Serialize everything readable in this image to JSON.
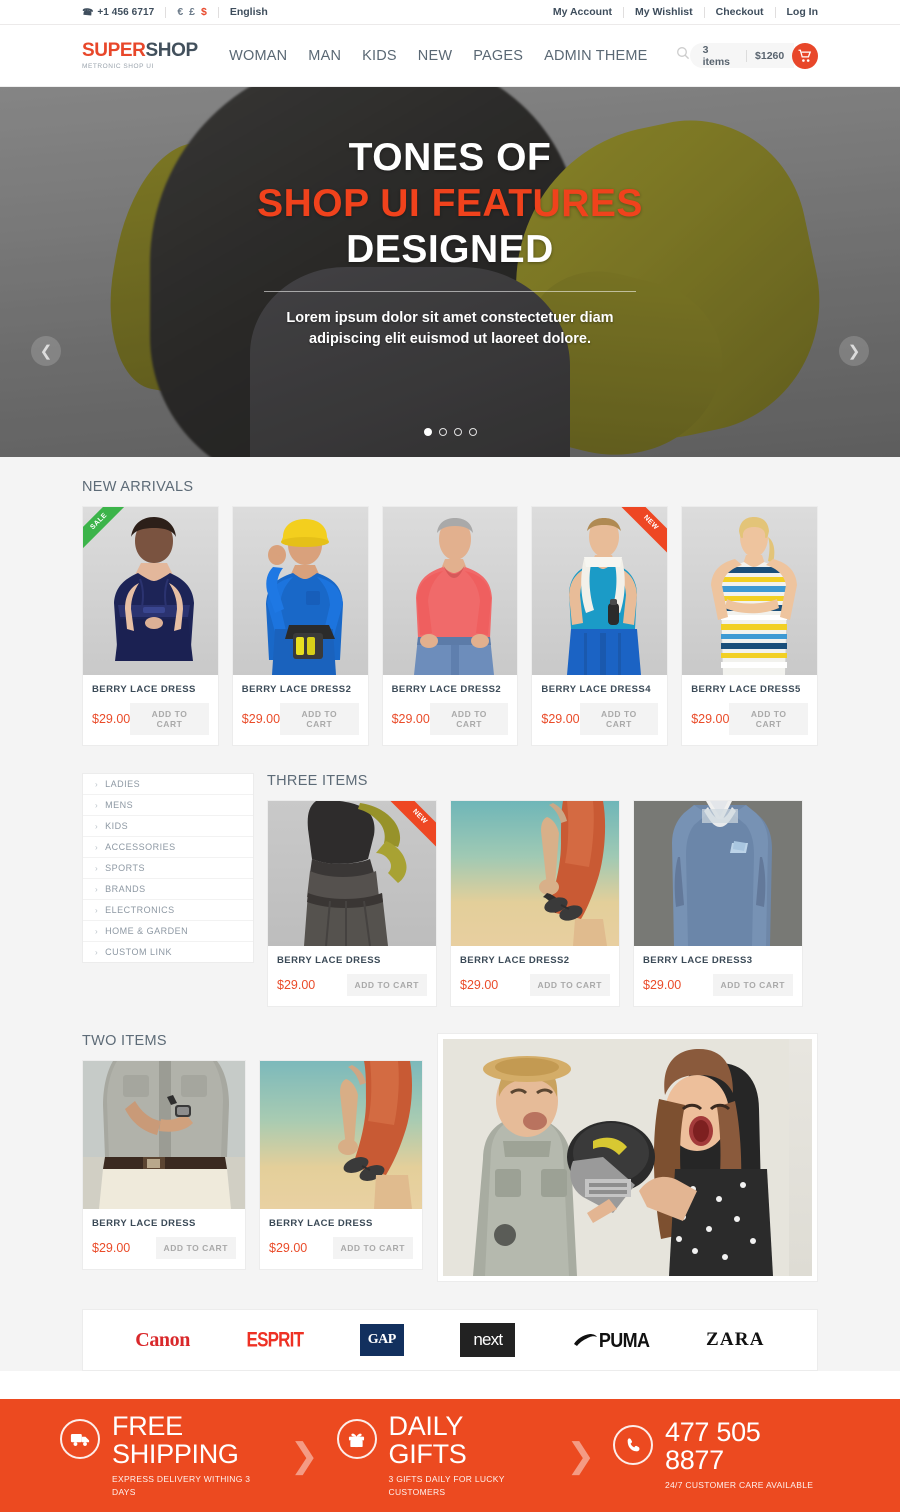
{
  "topbar": {
    "phone": "+1 456 6717",
    "phone_icon": "phone-icon",
    "currencies": [
      {
        "symbol": "€",
        "active": false
      },
      {
        "symbol": "£",
        "active": false
      },
      {
        "symbol": "$",
        "active": true
      }
    ],
    "language": "English",
    "links": [
      "My Account",
      "My Wishlist",
      "Checkout",
      "Log In"
    ]
  },
  "header": {
    "logo_part1": "SUPER",
    "logo_part2": "SHOP",
    "logo_sub": "METRONIC SHOP UI",
    "nav": [
      "WOMAN",
      "MAN",
      "KIDS",
      "NEW",
      "PAGES",
      "ADMIN THEME"
    ],
    "search_icon": "search-icon",
    "cart_items": "3 items",
    "cart_total": "$1260",
    "cart_icon": "shopping-cart-icon"
  },
  "hero": {
    "line1": "TONES OF",
    "line2": "SHOP UI FEATURES",
    "line3": "DESIGNED",
    "subtitle_1": "Lorem ipsum dolor sit amet constectetuer diam",
    "subtitle_2": "adipiscing elit euismod ut laoreet dolore.",
    "prev_icon": "chevron-left-icon",
    "next_icon": "chevron-right-icon",
    "slides": 4,
    "active_slide": 1,
    "accent_color": "#f0421c"
  },
  "new_arrivals": {
    "title": "NEW ARRIVALS",
    "products": [
      {
        "name": "BERRY LACE DRESS",
        "price": "$29.00",
        "cta": "ADD TO CART",
        "badge": "SALE",
        "badge_type": "sale"
      },
      {
        "name": "BERRY LACE DRESS2",
        "price": "$29.00",
        "cta": "ADD TO CART",
        "badge": "",
        "badge_type": ""
      },
      {
        "name": "BERRY LACE DRESS2",
        "price": "$29.00",
        "cta": "ADD TO CART",
        "badge": "",
        "badge_type": ""
      },
      {
        "name": "BERRY LACE DRESS4",
        "price": "$29.00",
        "cta": "ADD TO CART",
        "badge": "NEW",
        "badge_type": "new"
      },
      {
        "name": "BERRY LACE DRESS5",
        "price": "$29.00",
        "cta": "ADD TO CART",
        "badge": "",
        "badge_type": ""
      }
    ]
  },
  "categories": {
    "items": [
      "LADIES",
      "MENS",
      "KIDS",
      "ACCESSORIES",
      "SPORTS",
      "BRANDS",
      "ELECTRONICS",
      "HOME & GARDEN",
      "CUSTOM LINK"
    ],
    "arrow_icon": "chevron-right-icon"
  },
  "three_items": {
    "title": "THREE ITEMS",
    "products": [
      {
        "name": "BERRY LACE DRESS",
        "price": "$29.00",
        "cta": "ADD TO CART",
        "badge": "NEW",
        "badge_type": "new"
      },
      {
        "name": "BERRY LACE DRESS2",
        "price": "$29.00",
        "cta": "ADD TO CART",
        "badge": "",
        "badge_type": ""
      },
      {
        "name": "BERRY LACE DRESS3",
        "price": "$29.00",
        "cta": "ADD TO CART",
        "badge": "",
        "badge_type": ""
      }
    ]
  },
  "two_items": {
    "title": "TWO ITEMS",
    "products": [
      {
        "name": "BERRY LACE DRESS",
        "price": "$29.00",
        "cta": "ADD TO CART"
      },
      {
        "name": "BERRY LACE DRESS",
        "price": "$29.00",
        "cta": "ADD TO CART"
      }
    ]
  },
  "brands": [
    {
      "name": "Canon",
      "style": "canon"
    },
    {
      "name": "ESPRIT",
      "style": "esprit"
    },
    {
      "name": "GAP",
      "style": "gap"
    },
    {
      "name": "next",
      "style": "next"
    },
    {
      "name": "PUMA",
      "style": "puma"
    },
    {
      "name": "ZARA",
      "style": "zara"
    }
  ],
  "footer_banner": {
    "background": "#ec4a20",
    "items": [
      {
        "icon": "truck-icon",
        "title_1": "FREE",
        "title_2": "SHIPPING",
        "sub": "EXPRESS DELIVERY WITHING 3 DAYS"
      },
      {
        "icon": "gift-icon",
        "title_1": "DAILY",
        "title_2": "GIFTS",
        "sub": "3 GIFTS DAILY FOR LUCKY CUSTOMERS"
      },
      {
        "icon": "phone-icon",
        "title_1": "477 505",
        "title_2": "8877",
        "sub": "24/7 CUSTOMER CARE AVAILABLE"
      }
    ],
    "separator_icon": "chevron-right-icon"
  }
}
